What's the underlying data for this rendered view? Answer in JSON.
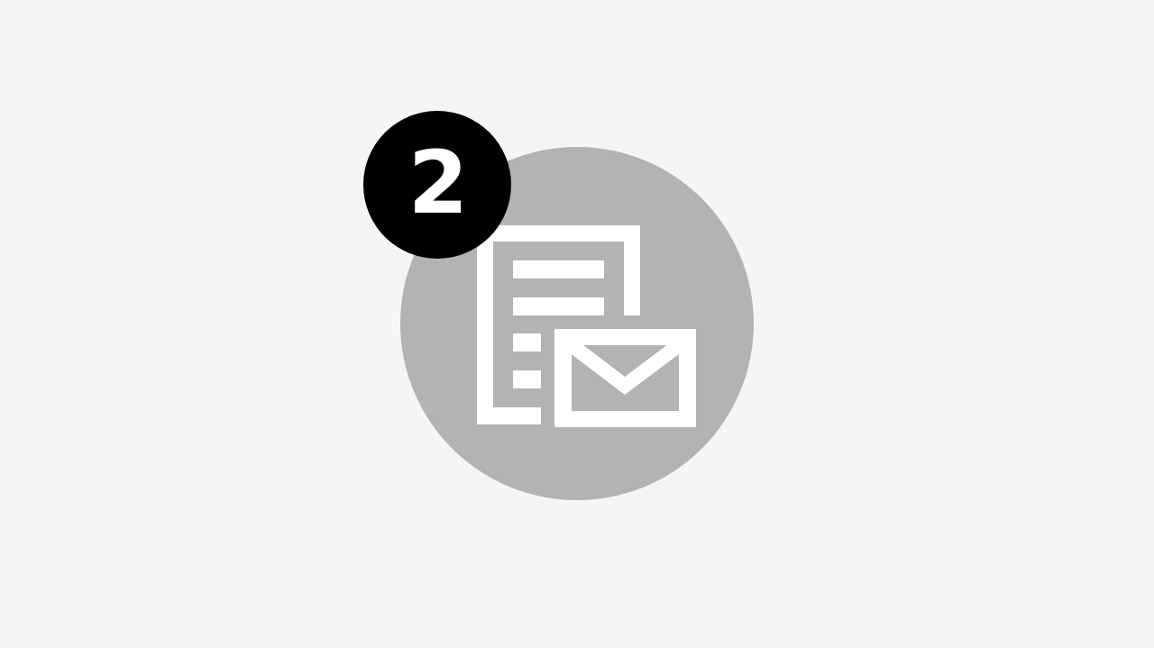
{
  "badge": {
    "count": "2"
  },
  "colors": {
    "background": "#f5f5f5",
    "circle": "#b3b3b3",
    "icon": "#ffffff",
    "badge_bg": "#000000",
    "badge_text": "#ffffff"
  },
  "icons": {
    "main": "document-with-envelope-icon"
  }
}
